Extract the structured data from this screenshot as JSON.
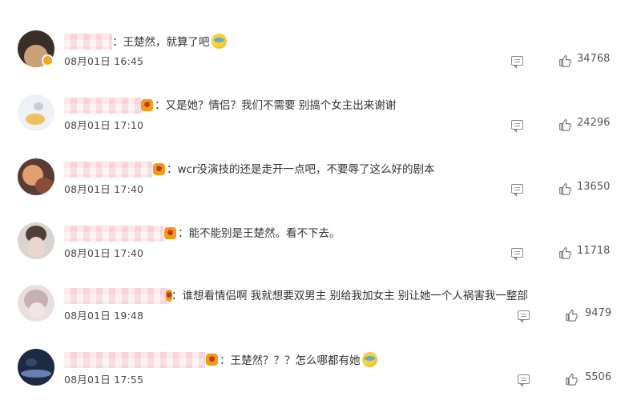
{
  "comments": [
    {
      "text": "：王楚然，就算了吧",
      "has_emoji": true,
      "has_badge": false,
      "time": "08月01日 16:45",
      "likes": "34768",
      "avatar_colors": [
        "#3a2e28",
        "#c9a27a"
      ]
    },
    {
      "text": "：又是她？情侣？我们不需要 别搞个女主出来谢谢",
      "has_emoji": false,
      "has_badge": true,
      "time": "08月01日 17:10",
      "likes": "24296",
      "avatar_colors": [
        "#eef1f6",
        "#f0c060"
      ]
    },
    {
      "text": "：wcr没演技的还是走开一点吧，不要辱了这么好的剧本",
      "has_emoji": false,
      "has_badge": true,
      "time": "08月01日 17:40",
      "likes": "13650",
      "avatar_colors": [
        "#5b3b35",
        "#e0a070"
      ]
    },
    {
      "text": "：能不能别是王楚然。看不下去。",
      "has_emoji": false,
      "has_badge": true,
      "time": "08月01日 17:40",
      "likes": "11718",
      "avatar_colors": [
        "#d9d4d0",
        "#8a7468"
      ]
    },
    {
      "text": "：谁想看情侣啊 我就想要双男主 别给我加女主 别让她一个人祸害我一整部",
      "has_emoji": false,
      "has_badge": true,
      "time": "08月01日 19:48",
      "likes": "9479",
      "avatar_colors": [
        "#e9dfdf",
        "#c7b0b3"
      ]
    },
    {
      "text": "：王楚然？？？怎么哪都有她",
      "has_emoji": true,
      "has_badge": true,
      "time": "08月01日 17:55",
      "likes": "5506",
      "avatar_colors": [
        "#1d2a44",
        "#6a7fb0"
      ]
    }
  ]
}
